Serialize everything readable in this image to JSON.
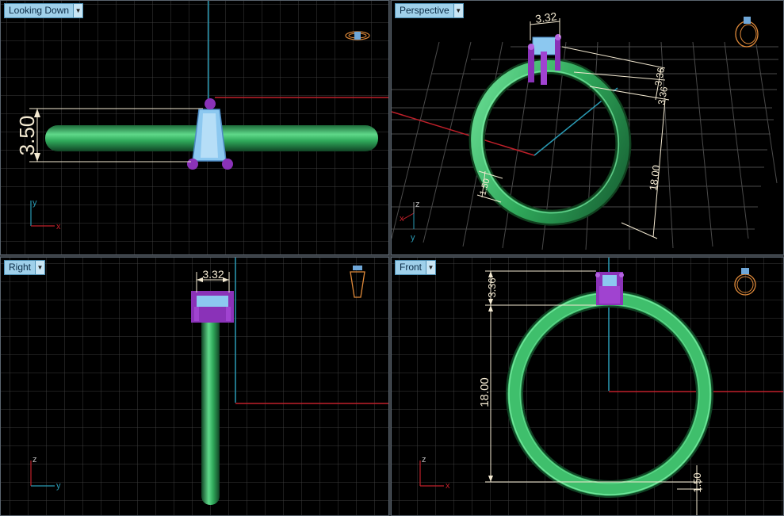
{
  "viewports": {
    "top": {
      "label": "Looking Down",
      "dim_height": "3.50"
    },
    "perspective": {
      "label": "Perspective",
      "dim_width": "3.32",
      "dim_a": "3.36",
      "dim_b": "3.36",
      "dim_c": "18.00",
      "dim_d": "1.50"
    },
    "right": {
      "label": "Right",
      "dim_width": "3.32"
    },
    "front": {
      "label": "Front",
      "dim_top": "3.36",
      "dim_diameter": "18.00",
      "dim_band": "1.50"
    }
  },
  "axes": {
    "x": "x",
    "y": "y",
    "z": "z"
  },
  "colors": {
    "viewport_bg": "#000000",
    "grid": "#3d3d3d",
    "ring": "#2fa85a",
    "setting_metal": "#8a32b8",
    "stone": "#8cc8f0",
    "axis_red": "#c0202a",
    "axis_cyan": "#2a9bb5",
    "dimension": "#f4ead2",
    "label_bg": "#9fd0ea"
  }
}
